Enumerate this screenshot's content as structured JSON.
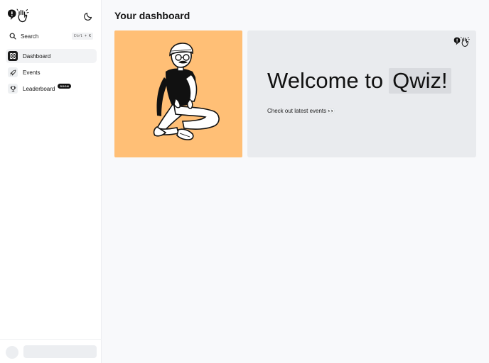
{
  "sidebar": {
    "search": {
      "label": "Search",
      "shortcut": "Ctrl + K"
    },
    "nav": [
      {
        "label": "Dashboard",
        "icon": "grid-icon",
        "active": true
      },
      {
        "label": "Events",
        "icon": "rocket-icon",
        "active": false
      },
      {
        "label": "Leaderboard",
        "icon": "trophy-icon",
        "active": false,
        "badge": "SOON"
      }
    ]
  },
  "main": {
    "title": "Your dashboard",
    "welcome": {
      "heading_prefix": "Welcome to",
      "heading_highlight": "Qwiz!",
      "subtitle": "Check out latest events 👀"
    }
  },
  "colors": {
    "accent_orange": "#ffbf76",
    "card_gray": "#e9ebee",
    "highlight_gray": "#d9dbdf"
  }
}
